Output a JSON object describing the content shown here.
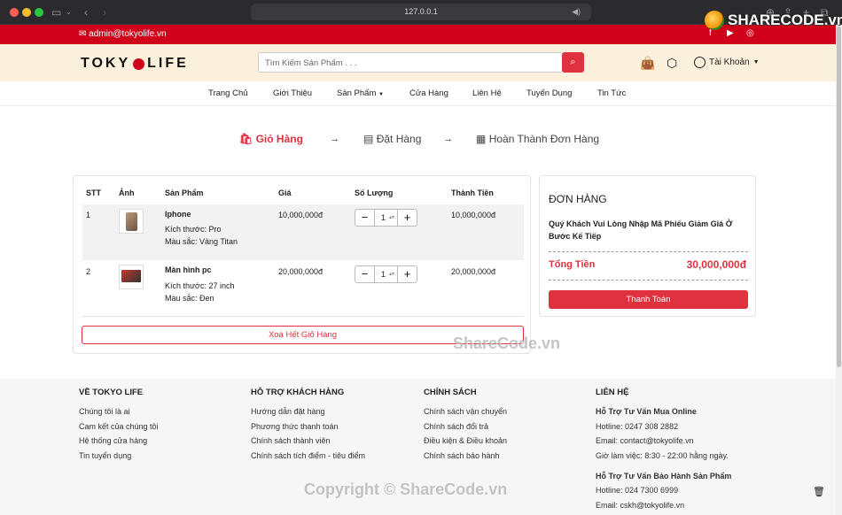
{
  "browser": {
    "url": "127.0.0.1"
  },
  "watermark": {
    "logo_text": "SHARECODE.vn",
    "center_text": "ShareCode.vn",
    "bottom_text": "Copyright © ShareCode.vn"
  },
  "topbar": {
    "email": "admin@tokyolife.vn"
  },
  "header": {
    "logo_left": "TOKY",
    "logo_right": "LIFE",
    "search_placeholder": "Tìm Kiếm Sản Phẩm . . .",
    "account_label": "Tài Khoản"
  },
  "nav": {
    "items": [
      "Trang Chủ",
      "Giới Thiệu",
      "Sản Phẩm",
      "Cửa Hàng",
      "Liên Hệ",
      "Tuyển Dụng",
      "Tin Tức"
    ]
  },
  "steps": {
    "cart": "Giỏ Hàng",
    "order": "Đặt Hàng",
    "complete": "Hoàn Thành Đơn Hàng"
  },
  "cart": {
    "headers": {
      "stt": "STT",
      "image": "Ảnh",
      "product": "Sản Phẩm",
      "price": "Giá",
      "qty": "Số Lượng",
      "total": "Thành Tiền"
    },
    "rows": [
      {
        "stt": "1",
        "name": "Iphone",
        "size": "Kích thước: Pro",
        "color": "Màu sắc: Vàng Titan",
        "price": "10,000,000đ",
        "qty": "1",
        "total": "10,000,000đ"
      },
      {
        "stt": "2",
        "name": "Màn hình pc",
        "size": "Kích thước: 27 inch",
        "color": "Màu sắc: Đen",
        "price": "20,000,000đ",
        "qty": "1",
        "total": "20,000,000đ"
      }
    ],
    "clear_label": "Xoá Hết Giỏ Hàng"
  },
  "order": {
    "title": "ĐƠN HÀNG",
    "note": "Quý Khách Vui Lòng Nhập Mã Phiếu Giảm Giá Ở Bước Kế Tiếp",
    "total_label": "Tổng Tiền",
    "total_value": "30,000,000đ",
    "pay_label": "Thanh Toán"
  },
  "footer": {
    "col1": {
      "title": "VỀ TOKYO LIFE",
      "links": [
        "Chúng tôi là ai",
        "Cam kết của chúng tôi",
        "Hệ thống cửa hàng",
        "Tin tuyển dụng"
      ]
    },
    "col2": {
      "title": "HỖ TRỢ KHÁCH HÀNG",
      "links": [
        "Hướng dẫn đặt hàng",
        "Phương thức thanh toán",
        "Chính sách thành viên",
        "Chính sách tích điểm - tiêu điểm"
      ]
    },
    "col3": {
      "title": "CHÍNH SÁCH",
      "links": [
        "Chính sách vận chuyển",
        "Chính sách đổi trả",
        "Điều kiện & Điều khoản",
        "Chính sách bảo hành"
      ]
    },
    "col4": {
      "title": "LIÊN HỆ",
      "online_title": "Hỗ Trợ Tư Vấn Mua Online",
      "online_hotline": "Hotline: 0247 308 2882",
      "online_email": "Email: contact@tokyolife.vn",
      "hours": "Giờ làm việc: 8:30 - 22:00 hằng ngày.",
      "warranty_title": "Hỗ Trợ Tư Vấn Bảo Hành Sản Phẩm",
      "warranty_hotline": "Hotline: 024 7300 6999",
      "warranty_email": "Email: cskh@tokyolife.vn"
    }
  },
  "colors": {
    "brand_red": "#d0021b",
    "accent": "#e0313f",
    "header_bg": "#fbf0dc"
  }
}
